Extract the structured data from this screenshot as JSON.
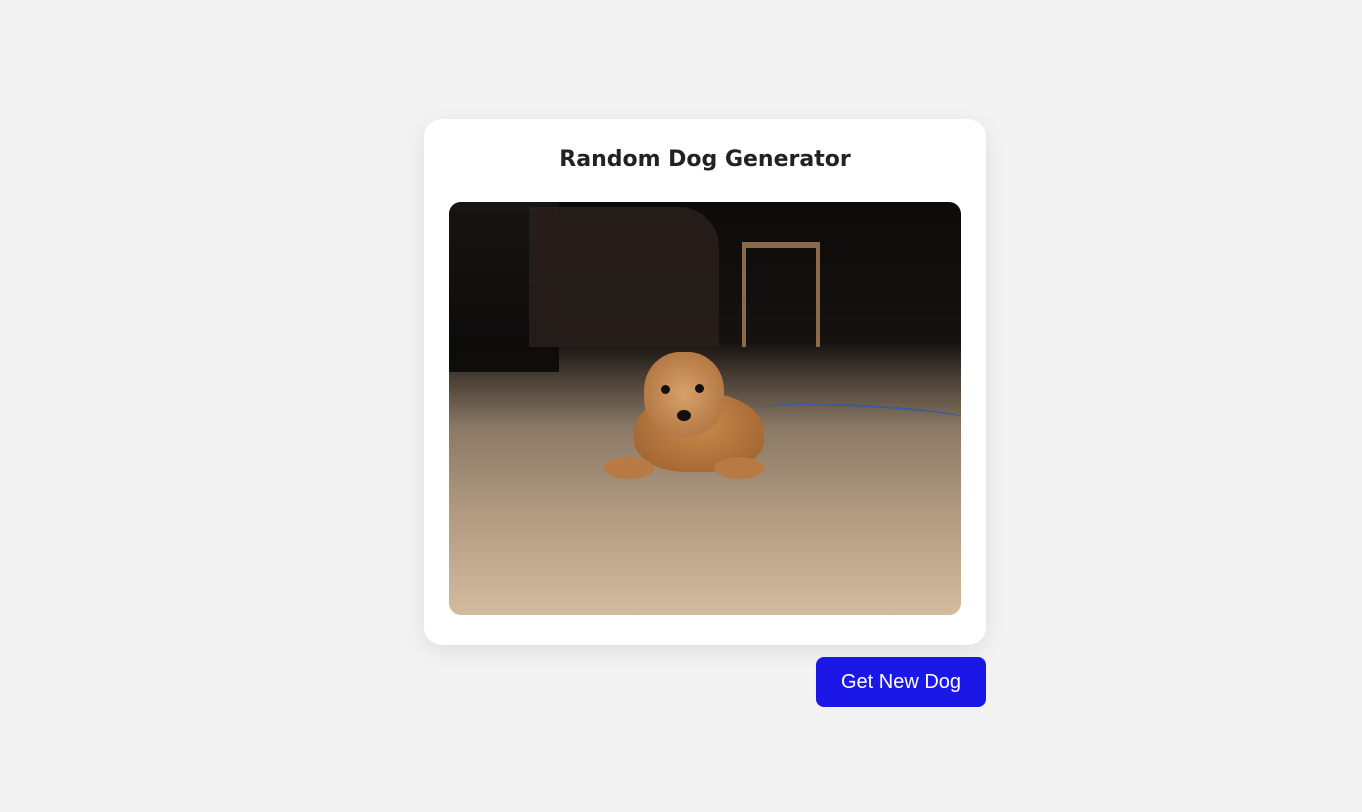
{
  "card": {
    "title": "Random Dog Generator",
    "image_alt": "Random dog"
  },
  "button": {
    "label": "Get New Dog",
    "color": "#1b17e6"
  }
}
